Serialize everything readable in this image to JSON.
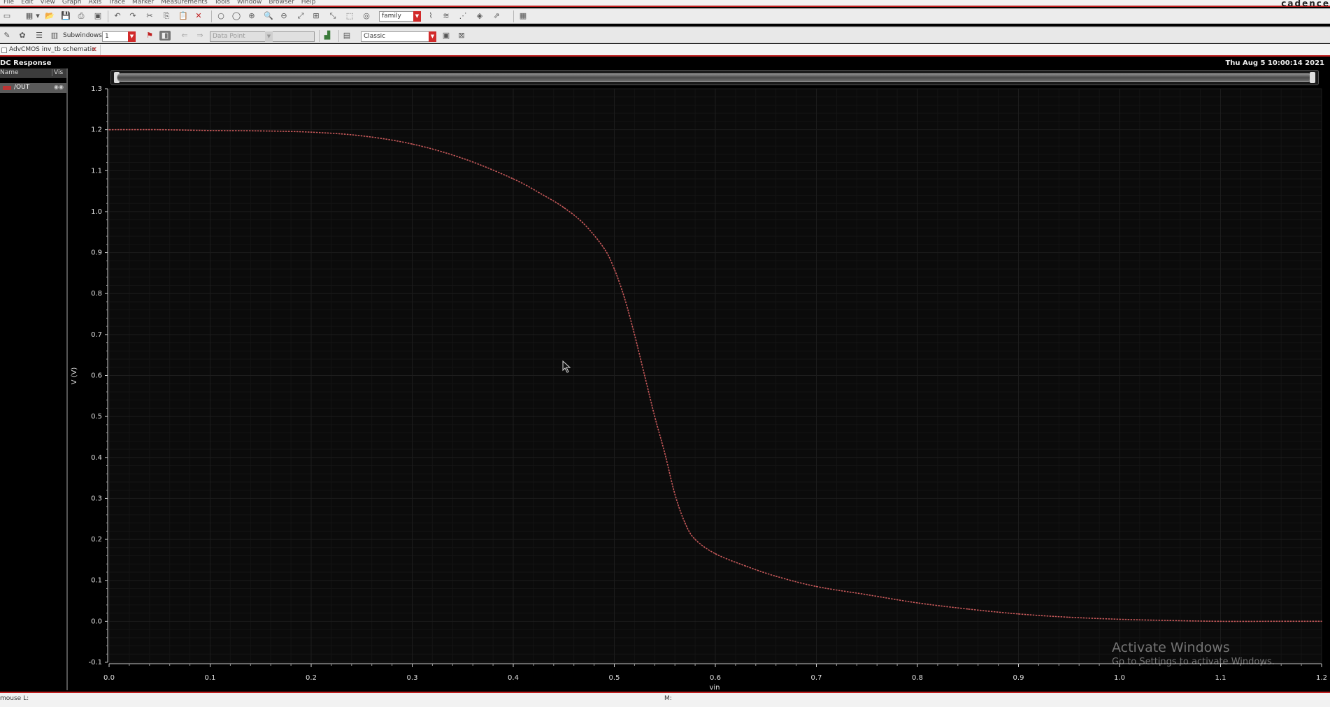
{
  "menubar": {
    "items": [
      "File",
      "Edit",
      "View",
      "Graph",
      "Axis",
      "Trace",
      "Marker",
      "Measurements",
      "Tools",
      "Window",
      "Browser",
      "Help"
    ],
    "brand": "cadence"
  },
  "toolbar1": {
    "family_combo": "family"
  },
  "toolbar2": {
    "subwindows_label": "Subwindows:",
    "subwindows_value": "1",
    "data_point_combo": "Data Point",
    "style_combo": "Classic"
  },
  "tab": {
    "label": "AdvCMOS inv_tb schematic"
  },
  "window": {
    "title": "DC Response",
    "timestamp": "Thu Aug 5 10:00:14 2021"
  },
  "trace_panel": {
    "col_name": "Name",
    "col_vis": "Vis",
    "traces": [
      {
        "label": "/OUT",
        "color": "#b33333"
      }
    ]
  },
  "colors": {
    "trace": "#c8595a",
    "plot_bg": "#0b0b0b",
    "grid": "#1d1d1d",
    "accent": "#c02020"
  },
  "chart_data": {
    "type": "line",
    "title": "DC Response",
    "xlabel": "vin",
    "ylabel": "V (V)",
    "xlim": [
      0.0,
      1.2
    ],
    "ylim": [
      -0.1,
      1.3
    ],
    "x_ticks": [
      "0.0",
      "0.1",
      "0.2",
      "0.3",
      "0.4",
      "0.5",
      "0.6",
      "0.7",
      "0.8",
      "0.9",
      "1.0",
      "1.1",
      "1.2"
    ],
    "y_ticks": [
      "1.3",
      "1.2",
      "1.1",
      "1.0",
      "0.9",
      "0.8",
      "0.7",
      "0.6",
      "0.5",
      "0.4",
      "0.3",
      "0.2",
      "0.1",
      "0.0",
      "-0.1"
    ],
    "grid": true,
    "series": [
      {
        "name": "/OUT",
        "x": [
          0.0,
          0.05,
          0.1,
          0.15,
          0.2,
          0.25,
          0.3,
          0.35,
          0.4,
          0.43,
          0.45,
          0.47,
          0.49,
          0.5,
          0.51,
          0.52,
          0.53,
          0.54,
          0.55,
          0.56,
          0.57,
          0.58,
          0.6,
          0.63,
          0.66,
          0.7,
          0.75,
          0.8,
          0.85,
          0.9,
          0.95,
          1.0,
          1.05,
          1.1,
          1.15,
          1.2
        ],
        "y": [
          1.2,
          1.2,
          1.198,
          1.197,
          1.194,
          1.185,
          1.165,
          1.13,
          1.08,
          1.04,
          1.01,
          0.97,
          0.91,
          0.86,
          0.79,
          0.7,
          0.6,
          0.5,
          0.41,
          0.31,
          0.24,
          0.2,
          0.165,
          0.135,
          0.11,
          0.085,
          0.065,
          0.045,
          0.03,
          0.018,
          0.01,
          0.005,
          0.002,
          0.0,
          0.0,
          0.0
        ]
      }
    ]
  },
  "statusbar": {
    "left": "mouse L:",
    "mid": "M:"
  },
  "watermark": {
    "title": "Activate Windows",
    "subtitle": "Go to Settings to activate Windows."
  }
}
